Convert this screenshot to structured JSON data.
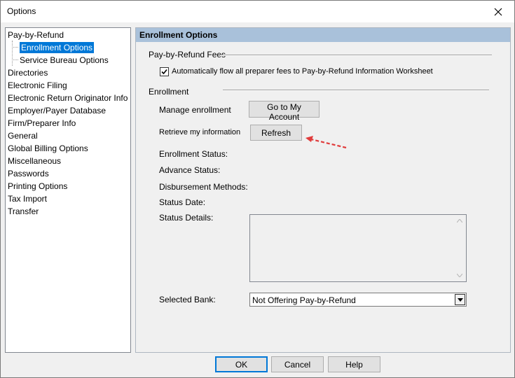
{
  "window": {
    "title": "Options"
  },
  "tree": {
    "items": [
      {
        "label": "Pay-by-Refund",
        "level": 0,
        "selected": false
      },
      {
        "label": "Enrollment Options",
        "level": 1,
        "selected": true
      },
      {
        "label": "Service Bureau Options",
        "level": 1,
        "selected": false
      },
      {
        "label": "Directories",
        "level": 0,
        "selected": false
      },
      {
        "label": "Electronic Filing",
        "level": 0,
        "selected": false
      },
      {
        "label": "Electronic Return Originator Info",
        "level": 0,
        "selected": false
      },
      {
        "label": "Employer/Payer Database",
        "level": 0,
        "selected": false
      },
      {
        "label": "Firm/Preparer Info",
        "level": 0,
        "selected": false
      },
      {
        "label": "General",
        "level": 0,
        "selected": false
      },
      {
        "label": "Global Billing Options",
        "level": 0,
        "selected": false
      },
      {
        "label": "Miscellaneous",
        "level": 0,
        "selected": false
      },
      {
        "label": "Passwords",
        "level": 0,
        "selected": false
      },
      {
        "label": "Printing Options",
        "level": 0,
        "selected": false
      },
      {
        "label": "Tax Import",
        "level": 0,
        "selected": false
      },
      {
        "label": "Transfer",
        "level": 0,
        "selected": false
      }
    ]
  },
  "panel": {
    "header": "Enrollment Options",
    "fees_group": "Pay-by-Refund Fees",
    "auto_flow_label": "Automatically flow all preparer fees to Pay-by-Refund Information Worksheet",
    "auto_flow_checked": true,
    "enrollment_group": "Enrollment",
    "manage_label": "Manage enrollment",
    "goto_account_button": "Go to My Account",
    "retrieve_label": "Retrieve my information",
    "refresh_button": "Refresh",
    "enrollment_status_label": "Enrollment Status:",
    "advance_status_label": "Advance Status:",
    "disbursement_label": "Disbursement Methods:",
    "status_date_label": "Status Date:",
    "status_details_label": "Status Details:",
    "status_details_value": "",
    "selected_bank_label": "Selected Bank:",
    "selected_bank_value": "Not Offering Pay-by-Refund"
  },
  "footer": {
    "ok": "OK",
    "cancel": "Cancel",
    "help": "Help"
  },
  "colors": {
    "selection": "#0078d7",
    "header_bg": "#a9c1da",
    "annotation_arrow": "#e03c3c"
  }
}
